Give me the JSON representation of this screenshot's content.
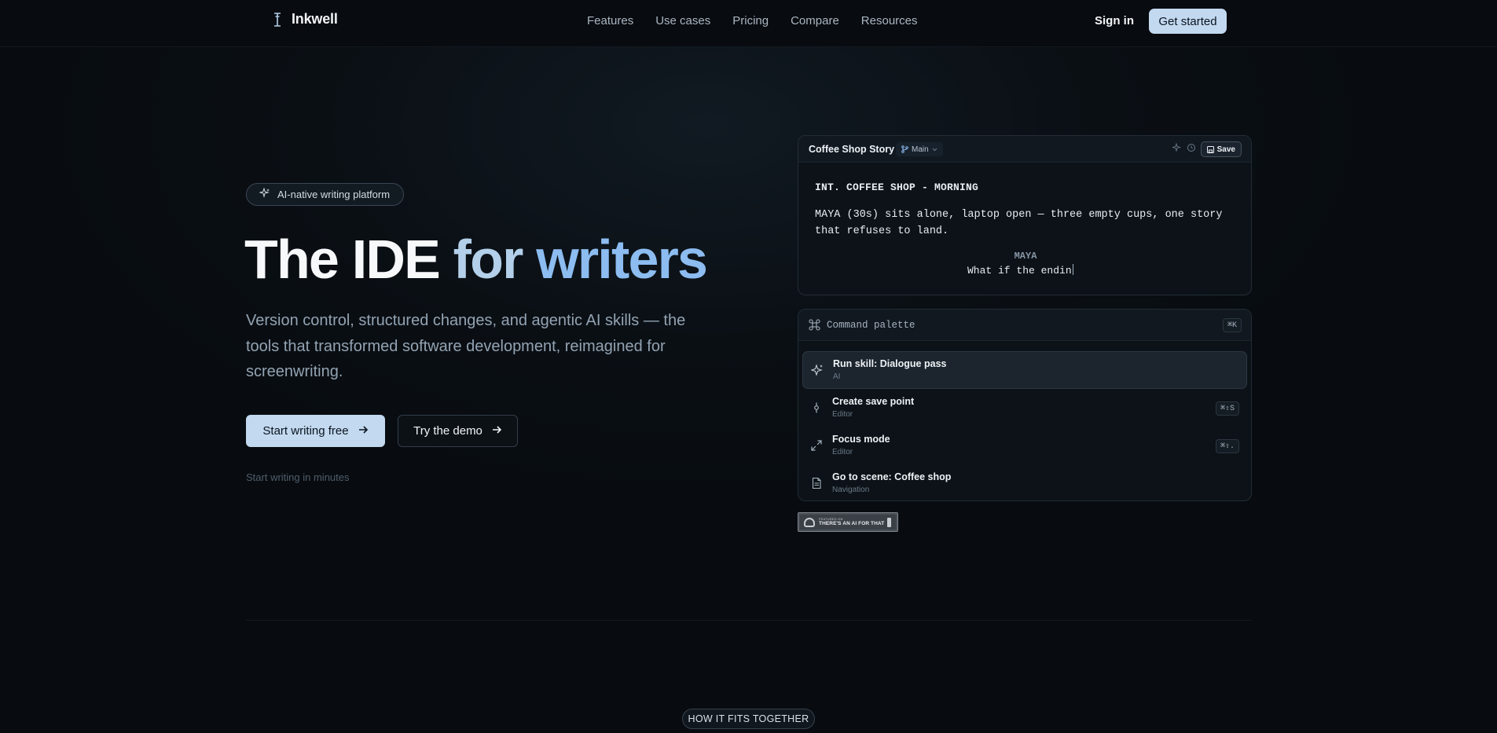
{
  "nav": {
    "brand": "Inkwell",
    "links": [
      "Features",
      "Use cases",
      "Pricing",
      "Compare",
      "Resources"
    ],
    "sign_in": "Sign in",
    "get_started": "Get started"
  },
  "hero": {
    "pill": "AI-native writing platform",
    "title_part1": "The IDE ",
    "title_part2": "for ",
    "title_part3": "writers",
    "subtitle": "Version control, structured changes, and agentic AI skills — the tools that transformed software development, reimagined for screenwriting.",
    "primary_cta": "Start writing free",
    "secondary_cta": "Try the demo",
    "note": "Start writing in minutes"
  },
  "editor": {
    "doc_title": "Coffee Shop Story",
    "branch": "Main",
    "save": "Save",
    "slugline": "INT. COFFEE SHOP - MORNING",
    "action": "MAYA (30s) sits alone, laptop open — three empty cups, one story that refuses to land.",
    "character": "MAYA",
    "dialogue": "What if the endin"
  },
  "palette": {
    "title": "Command palette",
    "shortcut": "⌘K",
    "items": [
      {
        "label": "Run skill: Dialogue pass",
        "category": "AI",
        "shortcut": "",
        "icon": "sparkle-icon"
      },
      {
        "label": "Create save point",
        "category": "Editor",
        "shortcut": "⌘⇧S",
        "icon": "commit-icon"
      },
      {
        "label": "Focus mode",
        "category": "Editor",
        "shortcut": "⌘⇧.",
        "icon": "expand-icon"
      },
      {
        "label": "Go to scene: Coffee shop",
        "category": "Navigation",
        "shortcut": "",
        "icon": "document-icon"
      }
    ]
  },
  "badge": {
    "small": "FEATURED ON",
    "text": "THERE'S AN AI FOR THAT"
  },
  "section": {
    "pill": "HOW IT FITS TOGETHER"
  },
  "colors": {
    "accent": "#c2d9ef",
    "title_blue_light": "#b3cfe9",
    "title_blue": "#8cbcf0",
    "background": "#0a0f14"
  }
}
